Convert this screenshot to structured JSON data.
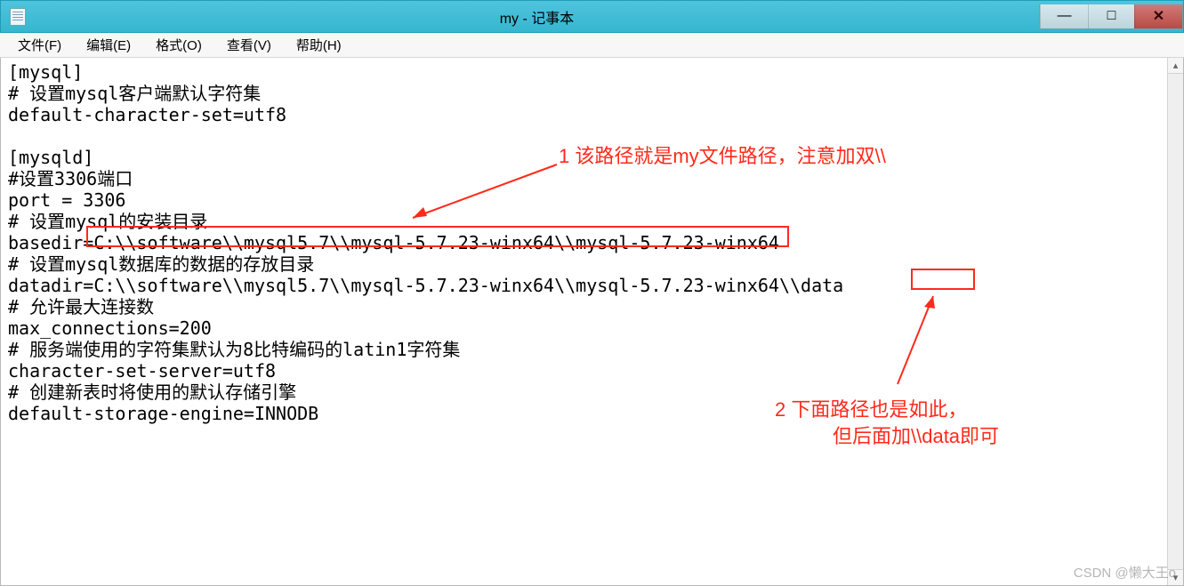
{
  "window": {
    "title": "my - 记事本"
  },
  "menu": {
    "file": "文件(F)",
    "edit": "编辑(E)",
    "format": "格式(O)",
    "view": "查看(V)",
    "help": "帮助(H)"
  },
  "content": {
    "lines": [
      "[mysql]",
      "# 设置mysql客户端默认字符集",
      "default-character-set=utf8",
      "",
      "[mysqld]",
      "#设置3306端口",
      "port = 3306",
      "# 设置mysql的安装目录",
      "basedir=C:\\\\software\\\\mysql5.7\\\\mysql-5.7.23-winx64\\\\mysql-5.7.23-winx64",
      "# 设置mysql数据库的数据的存放目录",
      "datadir=C:\\\\software\\\\mysql5.7\\\\mysql-5.7.23-winx64\\\\mysql-5.7.23-winx64\\\\data",
      "# 允许最大连接数",
      "max_connections=200",
      "# 服务端使用的字符集默认为8比特编码的latin1字符集",
      "character-set-server=utf8",
      "# 创建新表时将使用的默认存储引擎",
      "default-storage-engine=INNODB"
    ]
  },
  "annotations": {
    "note1": "1  该路径就是my文件路径，注意加双\\\\",
    "note2_line1": "2  下面路径也是如此，",
    "note2_line2": "但后面加\\\\data即可"
  },
  "watermark": "CSDN @懒大王o",
  "win_buttons": {
    "min": "—",
    "max": "□",
    "close": "✕"
  },
  "scroll": {
    "up": "▴",
    "down": "▾"
  }
}
